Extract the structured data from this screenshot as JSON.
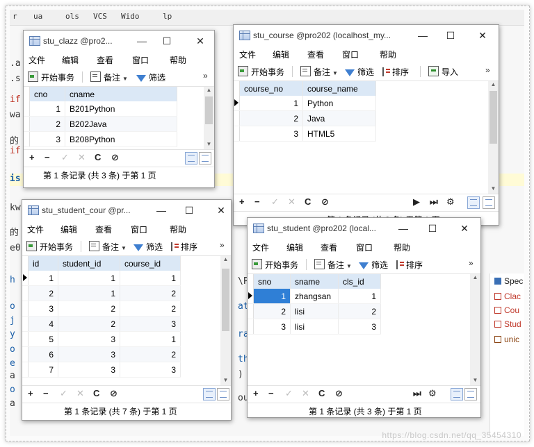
{
  "background": {
    "menu_fragments": [
      "r",
      "ua",
      "ols",
      "VCS",
      "Wido",
      "lp"
    ],
    "code_fragments": [
      ".a",
      ".s",
      "if",
      "wa",
      "的",
      "if",
      "is",
      "kw",
      "的",
      "e0",
      "h",
      "o",
      "j",
      "y",
      "o",
      "e",
      "a",
      "o",
      "a"
    ],
    "right_fragments": [
      "\\P",
      "at",
      "ra",
      "th",
      ")",
      "ou"
    ],
    "panel_items": [
      {
        "label": "Spec",
        "color": "#3a6fb5"
      },
      {
        "label": "Clac",
        "color": "#c0392b"
      },
      {
        "label": "Cou",
        "color": "#c0392b"
      },
      {
        "label": "Stud",
        "color": "#c0392b"
      },
      {
        "label": "unic",
        "color": "#8b4513"
      }
    ],
    "watermark": "https://blog.csdn.net/qq_35454310"
  },
  "windows": {
    "clazz": {
      "title": "stu_clazz @pro2...",
      "menu": [
        "文件",
        "编辑",
        "查看",
        "窗口",
        "帮助"
      ],
      "toolbar": {
        "begin_tx": "开始事务",
        "note": "备注",
        "filter": "筛选",
        "more": "»"
      },
      "columns": [
        "cno",
        "cname"
      ],
      "rows": [
        [
          "1",
          "B201Python"
        ],
        [
          "2",
          "B202Java"
        ],
        [
          "3",
          "B208Python"
        ]
      ],
      "status": "第 1 条记录 (共 3 条) 于第 1 页"
    },
    "course": {
      "title": "stu_course @pro202 (localhost_my...",
      "menu": [
        "文件",
        "编辑",
        "查看",
        "窗口",
        "帮助"
      ],
      "toolbar": {
        "begin_tx": "开始事务",
        "note": "备注",
        "filter": "筛选",
        "sort": "排序",
        "import": "导入",
        "more": "»"
      },
      "columns": [
        "course_no",
        "course_name"
      ],
      "rows": [
        [
          "1",
          "Python"
        ],
        [
          "2",
          "Java"
        ],
        [
          "3",
          "HTML5"
        ]
      ],
      "status": "第 1 条记录 (共 3 条) 于第 1 页"
    },
    "student_course": {
      "title": "stu_student_cour @pr...",
      "menu": [
        "文件",
        "编辑",
        "查看",
        "窗口",
        "帮助"
      ],
      "toolbar": {
        "begin_tx": "开始事务",
        "note": "备注",
        "filter": "筛选",
        "sort": "排序",
        "more": "»"
      },
      "columns": [
        "id",
        "student_id",
        "course_id"
      ],
      "rows": [
        [
          "1",
          "1",
          "1"
        ],
        [
          "2",
          "1",
          "2"
        ],
        [
          "3",
          "2",
          "2"
        ],
        [
          "4",
          "2",
          "3"
        ],
        [
          "5",
          "3",
          "1"
        ],
        [
          "6",
          "3",
          "2"
        ],
        [
          "7",
          "3",
          "3"
        ]
      ],
      "status": "第 1 条记录 (共 7 条) 于第 1 页"
    },
    "student": {
      "title": "stu_student @pro202 (local...",
      "menu": [
        "文件",
        "编辑",
        "查看",
        "窗口",
        "帮助"
      ],
      "toolbar": {
        "begin_tx": "开始事务",
        "note": "备注",
        "filter": "筛选",
        "sort": "排序",
        "more": "»"
      },
      "columns": [
        "sno",
        "sname",
        "cls_id"
      ],
      "rows": [
        [
          "1",
          "zhangsan",
          "1"
        ],
        [
          "2",
          "lisi",
          "2"
        ],
        [
          "3",
          "lisi",
          "3"
        ]
      ],
      "status": "第 1 条记录 (共 3 条) 于第 1 页"
    }
  },
  "window_controls": {
    "minimize": "—",
    "maximize": "☐",
    "close": "✕"
  },
  "nav_glyphs": {
    "add": "+",
    "remove": "−",
    "apply": "✓",
    "cancel": "✕",
    "refresh": "C",
    "stop": "⊘",
    "next": "▶",
    "last": "⏭",
    "settings": "⚙"
  }
}
